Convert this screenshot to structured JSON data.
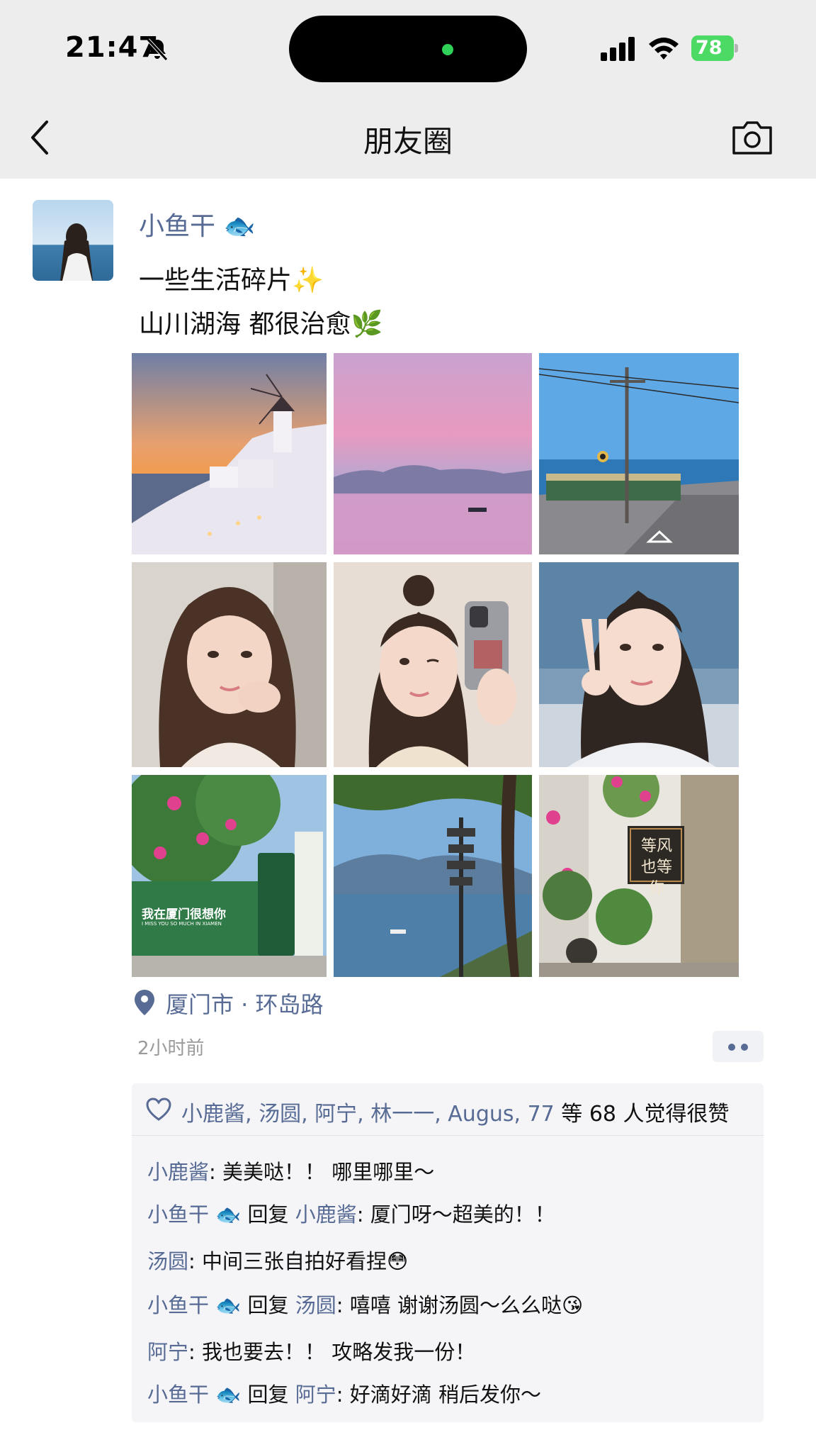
{
  "status_bar": {
    "time": "21:47",
    "battery": "78"
  },
  "nav": {
    "title": "朋友圈"
  },
  "post": {
    "author": "小鱼干 🐟",
    "lines": [
      "一些生活碎片✨",
      "山川湖海 都很治愈🌿"
    ],
    "photo_sign_texts": {
      "xiamen_sign": "我在厦门很想你",
      "xiamen_sign_sub": "I MISS YOU SO MUCH IN XIAMEN",
      "shop_sign": "等风也等你"
    },
    "location": "厦门市 · 环岛路",
    "time": "2小时前"
  },
  "likes": {
    "names": "小鹿酱, 汤圆, 阿宁, 林一一, Augus, 77",
    "suffix": " 等 68 人觉得很赞"
  },
  "comments": [
    {
      "name": "小鹿酱",
      "reply_to": "",
      "text": ": 美美哒！！ 哪里哪里～"
    },
    {
      "name": "小鱼干 🐟",
      "reply_word": " 回复 ",
      "reply_to": "小鹿酱",
      "text": ": 厦门呀～超美的！！"
    },
    {
      "name": "汤圆",
      "reply_to": "",
      "text": ": 中间三张自拍好看捏😳"
    },
    {
      "name": "小鱼干 🐟",
      "reply_word": " 回复 ",
      "reply_to": "汤圆",
      "text": ": 嘻嘻 谢谢汤圆～么么哒😘"
    },
    {
      "name": "阿宁",
      "reply_to": "",
      "text": ": 我也要去！！ 攻略发我一份！"
    },
    {
      "name": "小鱼干 🐟",
      "reply_word": " 回复 ",
      "reply_to": "阿宁",
      "text": ": 好滴好滴 稍后发你～"
    }
  ],
  "colors": {
    "link": "#576b95",
    "bar_bg": "#ededed",
    "panel_bg": "#f5f5f7",
    "battery": "#4cd964"
  }
}
